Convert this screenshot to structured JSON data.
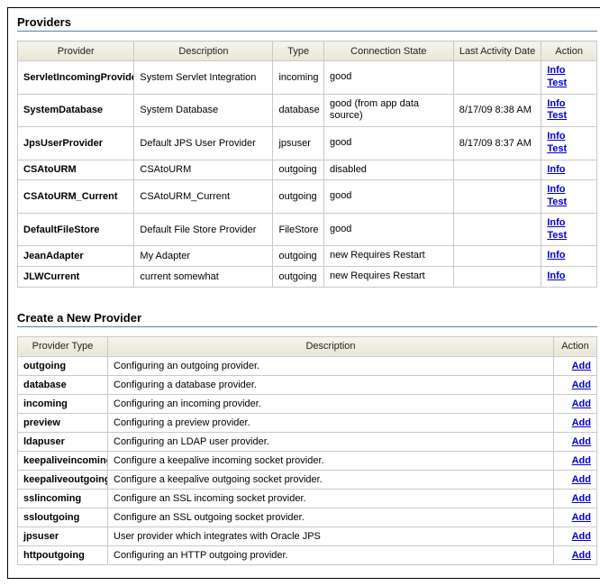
{
  "titles": {
    "providers": "Providers",
    "create": "Create a New Provider"
  },
  "providers_table": {
    "headers": [
      "Provider",
      "Description",
      "Type",
      "Connection State",
      "Last Activity Date",
      "Action"
    ],
    "rows": [
      {
        "provider": "ServletIncomingProvider",
        "desc": "System Servlet Integration",
        "type": "incoming",
        "state": "good",
        "date": "",
        "actions": [
          "Info",
          "Test"
        ]
      },
      {
        "provider": "SystemDatabase",
        "desc": "System Database",
        "type": "database",
        "state": "good (from app data source)",
        "date": "8/17/09 8:38 AM",
        "actions": [
          "Info",
          "Test"
        ]
      },
      {
        "provider": "JpsUserProvider",
        "desc": "Default JPS User Provider",
        "type": "jpsuser",
        "state": "good",
        "date": "8/17/09 8:37 AM",
        "actions": [
          "Info",
          "Test"
        ]
      },
      {
        "provider": "CSAtoURM",
        "desc": "CSAtoURM",
        "type": "outgoing",
        "state": "disabled",
        "date": "",
        "actions": [
          "Info"
        ]
      },
      {
        "provider": "CSAtoURM_Current",
        "desc": "CSAtoURM_Current",
        "type": "outgoing",
        "state": "good",
        "date": "",
        "actions": [
          "Info",
          "Test"
        ]
      },
      {
        "provider": "DefaultFileStore",
        "desc": "Default File Store Provider",
        "type": "FileStore",
        "state": "good",
        "date": "",
        "actions": [
          "Info",
          "Test"
        ]
      },
      {
        "provider": "JeanAdapter",
        "desc": "My Adapter",
        "type": "outgoing",
        "state": "new\nRequires Restart",
        "date": "",
        "actions": [
          "Info"
        ]
      },
      {
        "provider": "JLWCurrent",
        "desc": "current somewhat",
        "type": "outgoing",
        "state": "new\nRequires Restart",
        "date": "",
        "actions": [
          "Info"
        ]
      }
    ]
  },
  "create_table": {
    "headers": [
      "Provider Type",
      "Description",
      "Action"
    ],
    "action_label": "Add",
    "rows": [
      {
        "type": "outgoing",
        "desc": "Configuring an outgoing provider."
      },
      {
        "type": "database",
        "desc": "Configuring a database provider."
      },
      {
        "type": "incoming",
        "desc": "Configuring an incoming provider."
      },
      {
        "type": "preview",
        "desc": "Configuring a preview provider."
      },
      {
        "type": "ldapuser",
        "desc": "Configuring an LDAP user provider."
      },
      {
        "type": "keepaliveincoming",
        "desc": "Configure a keepalive incoming socket provider."
      },
      {
        "type": "keepaliveoutgoing",
        "desc": "Configure a keepalive outgoing socket provider."
      },
      {
        "type": "sslincoming",
        "desc": "Configure an SSL incoming socket provider."
      },
      {
        "type": "ssloutgoing",
        "desc": "Configure an SSL outgoing socket provider."
      },
      {
        "type": "jpsuser",
        "desc": "User provider which integrates with Oracle JPS"
      },
      {
        "type": "httpoutgoing",
        "desc": "Configuring an HTTP outgoing provider."
      }
    ]
  }
}
